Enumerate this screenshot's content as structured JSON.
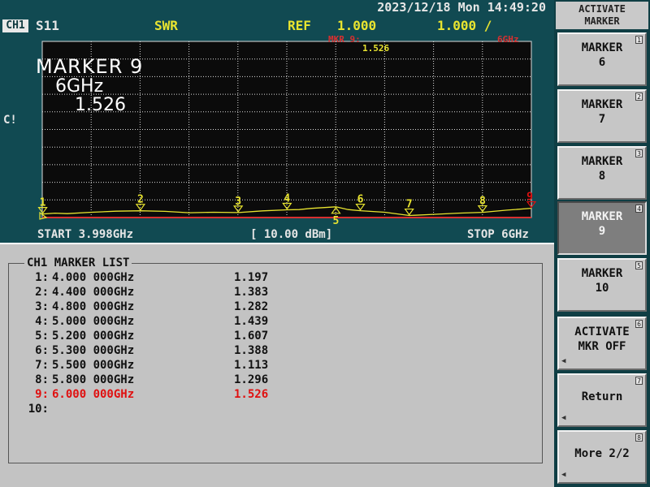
{
  "header": {
    "datetime": "2023/12/18 Mon 14:49:20",
    "channel": "CH1",
    "parameter": "S11",
    "format": "SWR",
    "ref_label": "REF",
    "ref_value": "1.000",
    "scale_value": "1.000 /",
    "marker_readout_label": "MKR  9:",
    "marker_readout_freq": "6GHz",
    "marker_readout_value": "1.526",
    "correction_flag": "C!"
  },
  "active_marker": {
    "title": "MARKER 9",
    "freq": "6GHz",
    "value": "1.526"
  },
  "sweep": {
    "start": "START 3.998GHz",
    "scale": "[ 10.00 dBm]",
    "stop": "STOP 6GHz"
  },
  "colors": {
    "trace": "#e8e430",
    "grid": "#dcdcdc",
    "reference_line": "#d83030",
    "active_marker": "#e01010"
  },
  "trace": {
    "name": "SWR",
    "x_range": [
      3.998,
      6.0
    ],
    "y_range": [
      1.0,
      11.0
    ],
    "points": [
      [
        3.998,
        1.2
      ],
      [
        4.05,
        1.25
      ],
      [
        4.1,
        1.22
      ],
      [
        4.2,
        1.3
      ],
      [
        4.3,
        1.36
      ],
      [
        4.4,
        1.383
      ],
      [
        4.5,
        1.35
      ],
      [
        4.6,
        1.27
      ],
      [
        4.7,
        1.3
      ],
      [
        4.8,
        1.282
      ],
      [
        4.9,
        1.38
      ],
      [
        5.0,
        1.439
      ],
      [
        5.05,
        1.45
      ],
      [
        5.1,
        1.52
      ],
      [
        5.2,
        1.607
      ],
      [
        5.25,
        1.45
      ],
      [
        5.3,
        1.388
      ],
      [
        5.4,
        1.3
      ],
      [
        5.5,
        1.113
      ],
      [
        5.6,
        1.18
      ],
      [
        5.7,
        1.25
      ],
      [
        5.8,
        1.296
      ],
      [
        5.9,
        1.42
      ],
      [
        6.0,
        1.526
      ]
    ]
  },
  "markers": [
    {
      "label": "1",
      "freq": 4.0
    },
    {
      "label": "2",
      "freq": 4.4
    },
    {
      "label": "3",
      "freq": 4.8
    },
    {
      "label": "4",
      "freq": 5.0
    },
    {
      "label": "5",
      "freq": 5.2
    },
    {
      "label": "6",
      "freq": 5.3
    },
    {
      "label": "7",
      "freq": 5.5
    },
    {
      "label": "8",
      "freq": 5.8
    },
    {
      "label": "9",
      "freq": 6.0
    }
  ],
  "marker_list": {
    "title": "CH1 MARKER LIST",
    "rows": [
      {
        "idx": "1:",
        "freq": "4.000 000GHz",
        "value": "1.197"
      },
      {
        "idx": "2:",
        "freq": "4.400 000GHz",
        "value": "1.383"
      },
      {
        "idx": "3:",
        "freq": "4.800 000GHz",
        "value": "1.282"
      },
      {
        "idx": "4:",
        "freq": "5.000 000GHz",
        "value": "1.439"
      },
      {
        "idx": "5:",
        "freq": "5.200 000GHz",
        "value": "1.607"
      },
      {
        "idx": "6:",
        "freq": "5.300 000GHz",
        "value": "1.388"
      },
      {
        "idx": "7:",
        "freq": "5.500 000GHz",
        "value": "1.113"
      },
      {
        "idx": "8:",
        "freq": "5.800 000GHz",
        "value": "1.296"
      },
      {
        "idx": "9:",
        "freq": "6.000 000GHz",
        "value": "1.526"
      },
      {
        "idx": "10:",
        "freq": "",
        "value": ""
      }
    ]
  },
  "softkeys": {
    "title_line1": "ACTIVATE",
    "title_line2": "MARKER",
    "keys": [
      {
        "label": "MARKER\n6",
        "num": "1"
      },
      {
        "label": "MARKER\n7",
        "num": "2"
      },
      {
        "label": "MARKER\n8",
        "num": "3"
      },
      {
        "label": "MARKER\n9",
        "num": "4"
      },
      {
        "label": "MARKER\n10",
        "num": "5"
      },
      {
        "label": "ACTIVATE\nMKR OFF",
        "num": "6"
      },
      {
        "label": "Return",
        "num": "7"
      },
      {
        "label": "More 2/2",
        "num": "8"
      }
    ]
  }
}
